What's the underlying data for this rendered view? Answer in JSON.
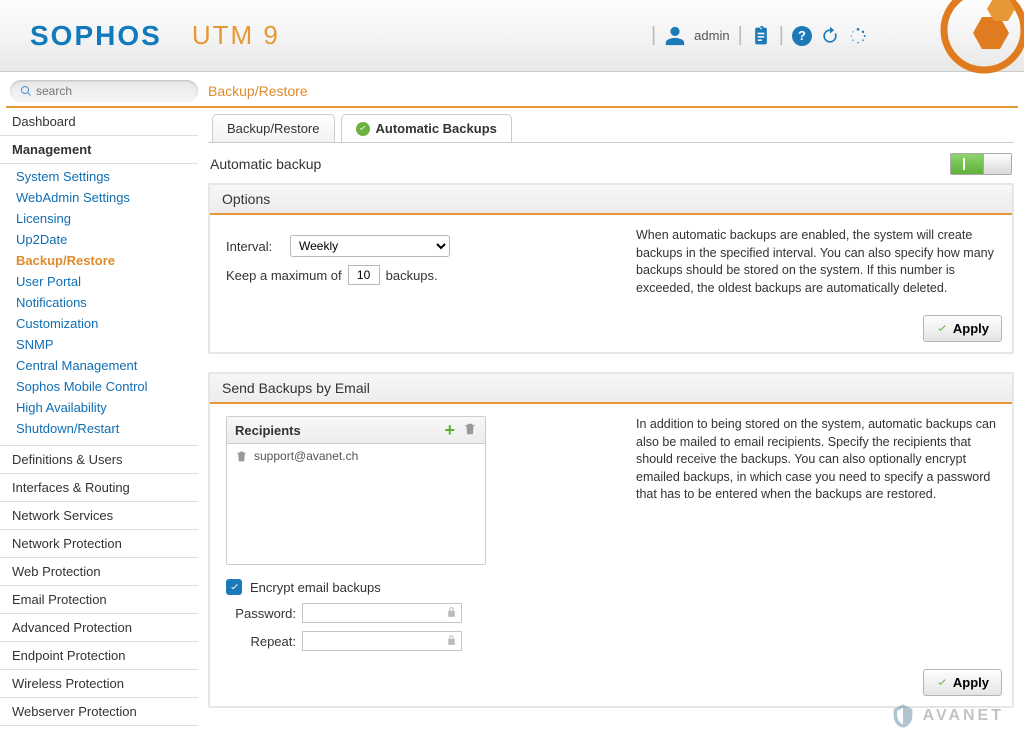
{
  "header": {
    "brand": "SOPHOS",
    "product": "UTM 9",
    "user": "admin"
  },
  "search": {
    "placeholder": "search"
  },
  "breadcrumb": "Backup/Restore",
  "sidebar": {
    "top": "Dashboard",
    "management_label": "Management",
    "items": [
      "System Settings",
      "WebAdmin Settings",
      "Licensing",
      "Up2Date",
      "Backup/Restore",
      "User Portal",
      "Notifications",
      "Customization",
      "SNMP",
      "Central Management",
      "Sophos Mobile Control",
      "High Availability",
      "Shutdown/Restart"
    ],
    "sections": [
      "Definitions & Users",
      "Interfaces & Routing",
      "Network Services",
      "Network Protection",
      "Web Protection",
      "Email Protection",
      "Advanced Protection",
      "Endpoint Protection",
      "Wireless Protection",
      "Webserver Protection"
    ]
  },
  "tabs": {
    "t1": "Backup/Restore",
    "t2": "Automatic Backups"
  },
  "auto": {
    "title": "Automatic backup",
    "options_header": "Options",
    "interval_label": "Interval:",
    "interval_value": "Weekly",
    "keep_prefix": "Keep a maximum of",
    "keep_value": "10",
    "keep_suffix": "backups.",
    "options_help": "When automatic backups are enabled, the system will create backups in the specified interval. You can also specify how many backups should be stored on the system. If this number is exceeded, the oldest backups are automatically deleted.",
    "apply": "Apply",
    "email_header": "Send Backups by Email",
    "recipients_label": "Recipients",
    "recipient": "support@avanet.ch",
    "email_help": "In addition to being stored on the system, automatic backups can also be mailed to email recipients. Specify the recipients that should receive the backups. You can also optionally encrypt emailed backups, in which case you need to specify a password that has to be entered when the backups are restored.",
    "encrypt_label": "Encrypt email backups",
    "password_label": "Password:",
    "repeat_label": "Repeat:"
  },
  "watermark": "AVANET"
}
